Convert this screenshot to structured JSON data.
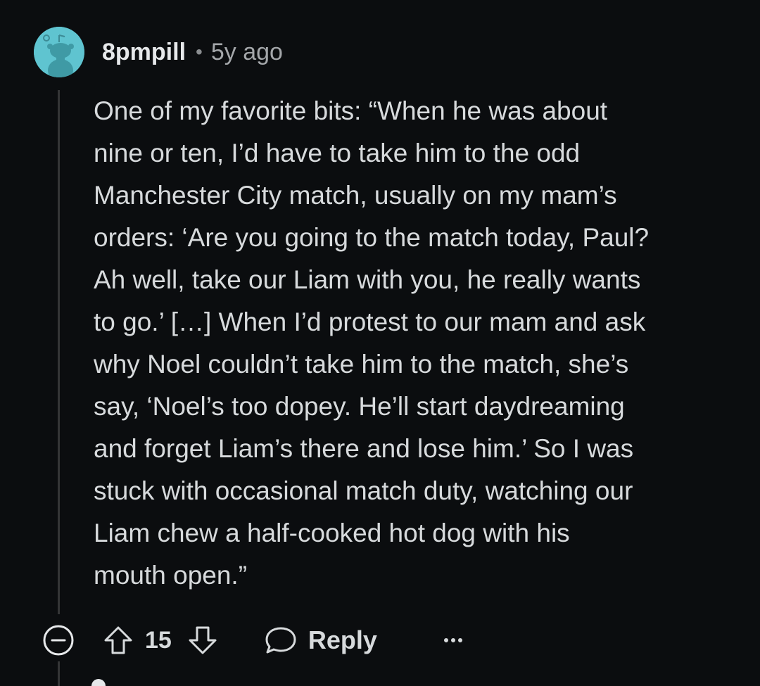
{
  "comment": {
    "author": "8pmpill",
    "separator": "•",
    "age": "5y ago",
    "avatar_icon": "snoo-avatar-icon",
    "avatar_color": "#5fc4d0",
    "body_lines": [
      "One of my favorite bits: “When he was about",
      "nine or ten, I’d have to take him to the odd",
      "Manchester City match, usually on my mam’s",
      "orders: ‘Are you going to the match today, Paul?",
      "Ah well, take our Liam with you, he really wants",
      "to go.’ […] When I’d protest to our mam and ask",
      "why Noel couldn’t take him to the match, she’s",
      "say, ‘Noel’s too dopey. He’ll start daydreaming",
      "and forget Liam’s there and lose him.’ So I was",
      "stuck with occasional match duty, watching our",
      "Liam chew a half-cooked hot dog with his",
      "mouth open.”"
    ]
  },
  "actions": {
    "collapse_icon": "collapse-minus-icon",
    "upvote_icon": "upvote-arrow-icon",
    "score": "15",
    "downvote_icon": "downvote-arrow-icon",
    "reply_icon": "speech-bubble-icon",
    "reply_label": "Reply",
    "more_icon": "more-dots-icon"
  }
}
